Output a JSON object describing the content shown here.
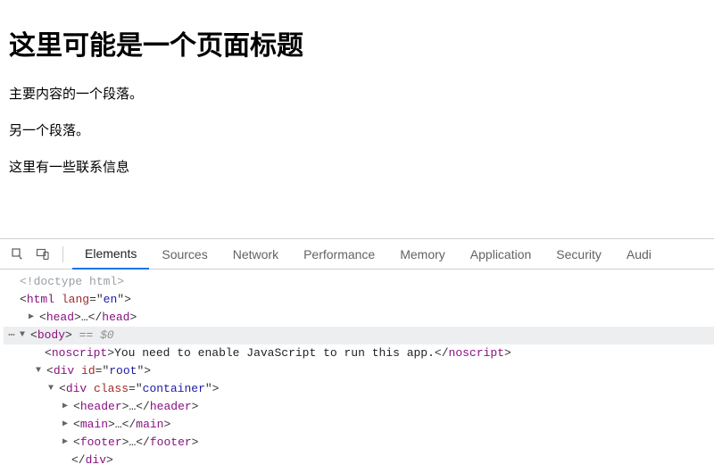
{
  "page": {
    "title": "这里可能是一个页面标题",
    "para1": "主要内容的一个段落。",
    "para2": "另一个段落。",
    "para3": "这里有一些联系信息"
  },
  "tabs": {
    "elements": "Elements",
    "sources": "Sources",
    "network": "Network",
    "performance": "Performance",
    "memory": "Memory",
    "application": "Application",
    "security": "Security",
    "audits": "Audi"
  },
  "dom": {
    "doctype": "<!doctype html>",
    "html_open": "<html lang=\"en\">",
    "head_open": "<head>",
    "head_ellipsis": "…",
    "head_close": "</head>",
    "body_open": "<body>",
    "body_eq": " == ",
    "body_dollar": "$0",
    "noscript_open": "<noscript>",
    "noscript_text": "You need to enable JavaScript to run this app.",
    "noscript_close": "</noscript>",
    "div_root_open": "<div id=\"root\">",
    "div_container_open": "<div class=\"container\">",
    "header_open": "<header>",
    "header_close": "</header>",
    "main_open": "<main>",
    "main_close": "</main>",
    "footer_open": "<footer>",
    "footer_close": "</footer>",
    "div_close": "</div>",
    "ellipsis": "…",
    "gutter_ellipsis": "⋯"
  }
}
